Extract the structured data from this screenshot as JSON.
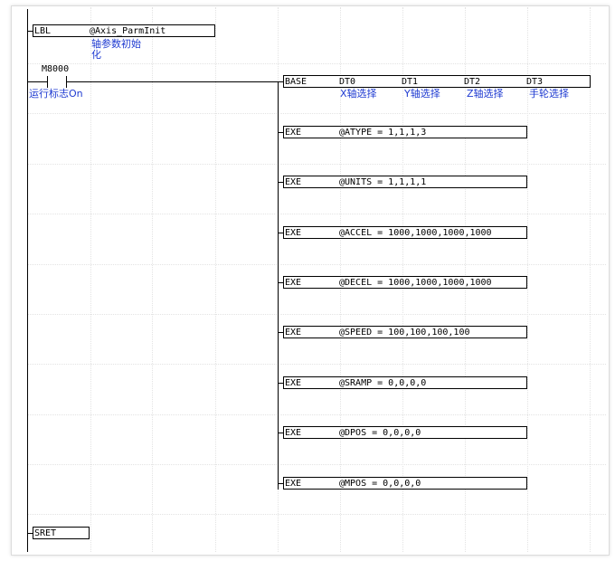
{
  "lbl": {
    "op": "LBL",
    "arg": "@Axis_ParmInit",
    "comment_1": "轴参数初始",
    "comment_2": "化"
  },
  "contact": {
    "name": "M8000",
    "comment": "运行标志On"
  },
  "base": {
    "op": "BASE",
    "params": [
      "DT0",
      "DT1",
      "DT2",
      "DT3"
    ],
    "comments": [
      "X轴选择",
      "Y轴选择",
      "Z轴选择",
      "手轮选择"
    ]
  },
  "exe": [
    {
      "op": "EXE",
      "expr": "@ATYPE = 1,1,1,3"
    },
    {
      "op": "EXE",
      "expr": "@UNITS = 1,1,1,1"
    },
    {
      "op": "EXE",
      "expr": "@ACCEL = 1000,1000,1000,1000"
    },
    {
      "op": "EXE",
      "expr": "@DECEL = 1000,1000,1000,1000"
    },
    {
      "op": "EXE",
      "expr": "@SPEED = 100,100,100,100"
    },
    {
      "op": "EXE",
      "expr": "@SRAMP = 0,0,0,0"
    },
    {
      "op": "EXE",
      "expr": "@DPOS = 0,0,0,0"
    },
    {
      "op": "EXE",
      "expr": "@MPOS = 0,0,0,0"
    }
  ],
  "sret": {
    "op": "SRET"
  }
}
